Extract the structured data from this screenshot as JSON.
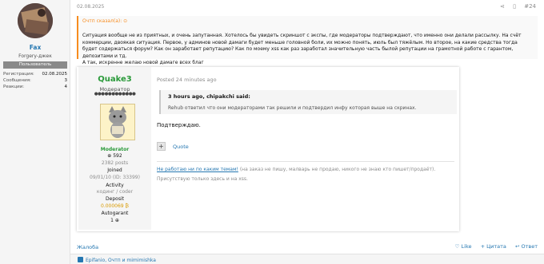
{
  "sidebar": {
    "username": "Fax",
    "user_title": "Forgery-джек",
    "banner": "Пользователь",
    "stats": [
      {
        "label": "Регистрация:",
        "value": "02.08.2025"
      },
      {
        "label": "Сообщения:",
        "value": "3"
      },
      {
        "label": "Реакции:",
        "value": "4"
      }
    ]
  },
  "post": {
    "date": "02.08.2025",
    "number": "#24",
    "quote_header": "Очтп сказал(а): ⊙",
    "quote_text": "Ситуация вообще не из приятных, и очень запутанная. Хотелось бы увидеть скриншот с экспы, где модераторы подтверждают, что именно они делали рассылку. На счёт коммерции, двоякая ситуация. Первое, у админов новой дамаги будет меньше головной боли, их можно понять, июль был тяжёлым. Но второе, на какие средства тогда будет содержаться форум? Как он заработает репутацию? Как по мо­ему xss как раз заработал значительную часть былой репутации на грамотной работе с гарантом, депозитами и тд.\nА так, искренне желаю новой дамаге всех благ",
    "complain": "Жалоба",
    "actions": {
      "like": "♡ Like",
      "quote": "+ Цитата",
      "reply": "↩ Ответ"
    },
    "likes": "Epifanio, Очтп и mimimishka"
  },
  "embed": {
    "username": "Quake3",
    "role": "Модератор",
    "dots": "●●●●●●●●●●●●",
    "badge": "Moderator",
    "rep": "⊕ 592",
    "posts": "2382 posts",
    "joined_label": "Joined",
    "joined_value": "09/01/10 (ID: 33399)",
    "activity_label": "Activity",
    "activity_value": "кодинг / coder",
    "deposit_label": "Deposit",
    "deposit_value": "0.000069 ₿",
    "autogarant_label": "Autogarant",
    "autogarant_value": "1 ⊕",
    "posted": "Posted 24 minutes ago",
    "iquote_header": "3 hours ago, chipakchi said:",
    "iquote_text": "Rehub ответил что они модераторами так решили и подтвердил инфу которая выше на скринах.",
    "reply": "Подтверждаю.",
    "plus": "+",
    "quote_btn": "Quote",
    "sig_link": "Не работаю ни по каким темам!",
    "sig_rest": " (на заказ не пишу, малварь не продаю, никого не знаю кто пишет/продаёт).",
    "sig2": "Присутствую только здесь и на xss."
  },
  "colors": {
    "accent": "#2577b1",
    "moderator": "#2a9a3a",
    "quote_bar": "#f78c1f",
    "deposit": "#d99a00"
  },
  "icons": [
    "share-icon",
    "bookmark-icon",
    "heart-icon",
    "user-avatar",
    "cat-avatar"
  ]
}
